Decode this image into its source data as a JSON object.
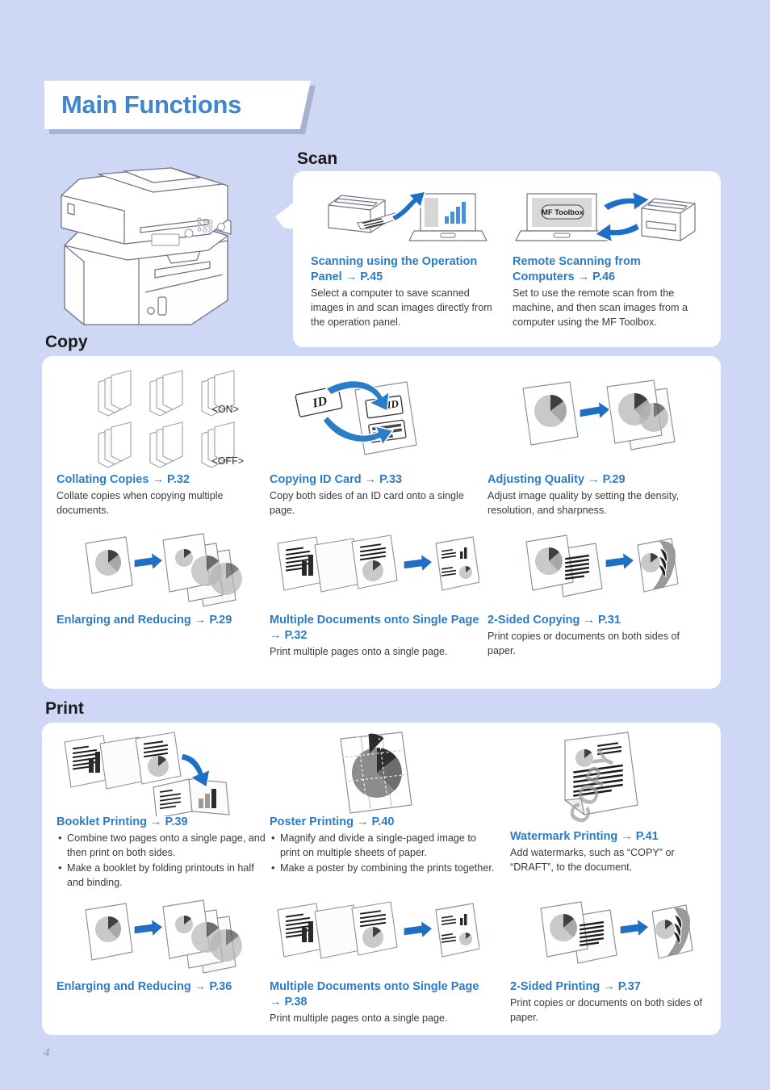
{
  "page": {
    "title": "Main Functions",
    "page_number": "4",
    "background_color": "#ced8f5",
    "link_color": "#2b7cc4",
    "title_color": "#3f86cc"
  },
  "device": {
    "icon": "multifunction-printer-illustration"
  },
  "sections": [
    {
      "id": "scan",
      "heading": "Scan",
      "items": [
        {
          "icon": "scan-to-computer-icon",
          "title": "Scanning using the Operation Panel",
          "arrow": "→",
          "page_ref": "P.45",
          "desc": "Select a computer to save scanned images in and scan images directly from the operation panel.",
          "bullets": []
        },
        {
          "icon": "remote-scan-icon",
          "icon_label": "MF Toolbox",
          "title": "Remote Scanning from Computers",
          "arrow": "→",
          "page_ref": "P.46",
          "desc": "Set to use the remote scan from the machine, and then scan images from a computer using the MF Toolbox.",
          "bullets": []
        }
      ]
    },
    {
      "id": "copy",
      "heading": "Copy",
      "items": [
        {
          "icon": "collate-copies-icon",
          "icon_label_on": "<ON>",
          "icon_label_off": "<OFF>",
          "title": "Collating Copies",
          "arrow": "→",
          "page_ref": "P.32",
          "desc": "Collate copies when copying multiple documents.",
          "bullets": []
        },
        {
          "icon": "copy-id-card-icon",
          "icon_label": "ID",
          "title": "Copying ID Card",
          "arrow": "→",
          "page_ref": "P.33",
          "desc": "Copy both sides of an ID card onto a single page.",
          "bullets": []
        },
        {
          "icon": "adjust-quality-icon",
          "title": "Adjusting Quality",
          "arrow": "→",
          "page_ref": "P.29",
          "desc": "Adjust image quality by setting the density, resolution, and sharpness.",
          "bullets": []
        },
        {
          "icon": "enlarge-reduce-icon",
          "title": "Enlarging and Reducing",
          "arrow": "→",
          "page_ref": "P.29",
          "desc": "",
          "bullets": []
        },
        {
          "icon": "n-up-icon",
          "title": "Multiple Documents onto Single Page",
          "arrow": "→",
          "page_ref": "P.32",
          "desc": "Print multiple pages onto a single page.",
          "bullets": []
        },
        {
          "icon": "two-sided-copy-icon",
          "title": "2-Sided Copying",
          "arrow": "→",
          "page_ref": "P.31",
          "desc": "Print copies or documents on both sides of paper.",
          "bullets": []
        }
      ]
    },
    {
      "id": "print",
      "heading": "Print",
      "items": [
        {
          "icon": "booklet-print-icon",
          "title": "Booklet Printing",
          "arrow": "→",
          "page_ref": "P.39",
          "desc": "",
          "bullets": [
            "Combine two pages onto a single page, and then print on both sides.",
            "Make a booklet by folding printouts in half and binding."
          ]
        },
        {
          "icon": "poster-print-icon",
          "title": "Poster Printing",
          "arrow": "→",
          "page_ref": "P.40",
          "desc": "",
          "bullets": [
            "Magnify and divide a single-paged image to print on multiple sheets of paper.",
            "Make a poster by combining the prints together."
          ]
        },
        {
          "icon": "watermark-print-icon",
          "title": "Watermark Printing",
          "arrow": "→",
          "page_ref": "P.41",
          "desc": "Add watermarks, such as “COPY” or “DRAFT”, to the document.",
          "bullets": []
        },
        {
          "icon": "enlarge-reduce-icon",
          "title": "Enlarging and Reducing",
          "arrow": "→",
          "page_ref": "P.36",
          "desc": "",
          "bullets": []
        },
        {
          "icon": "n-up-icon",
          "title": "Multiple Documents onto Single Page",
          "arrow": "→",
          "page_ref": "P.38",
          "desc": "Print multiple pages onto a single page.",
          "bullets": []
        },
        {
          "icon": "two-sided-print-icon",
          "title": "2-Sided Printing",
          "arrow": "→",
          "page_ref": "P.37",
          "desc": "Print copies or documents on both sides of paper.",
          "bullets": []
        }
      ]
    }
  ]
}
